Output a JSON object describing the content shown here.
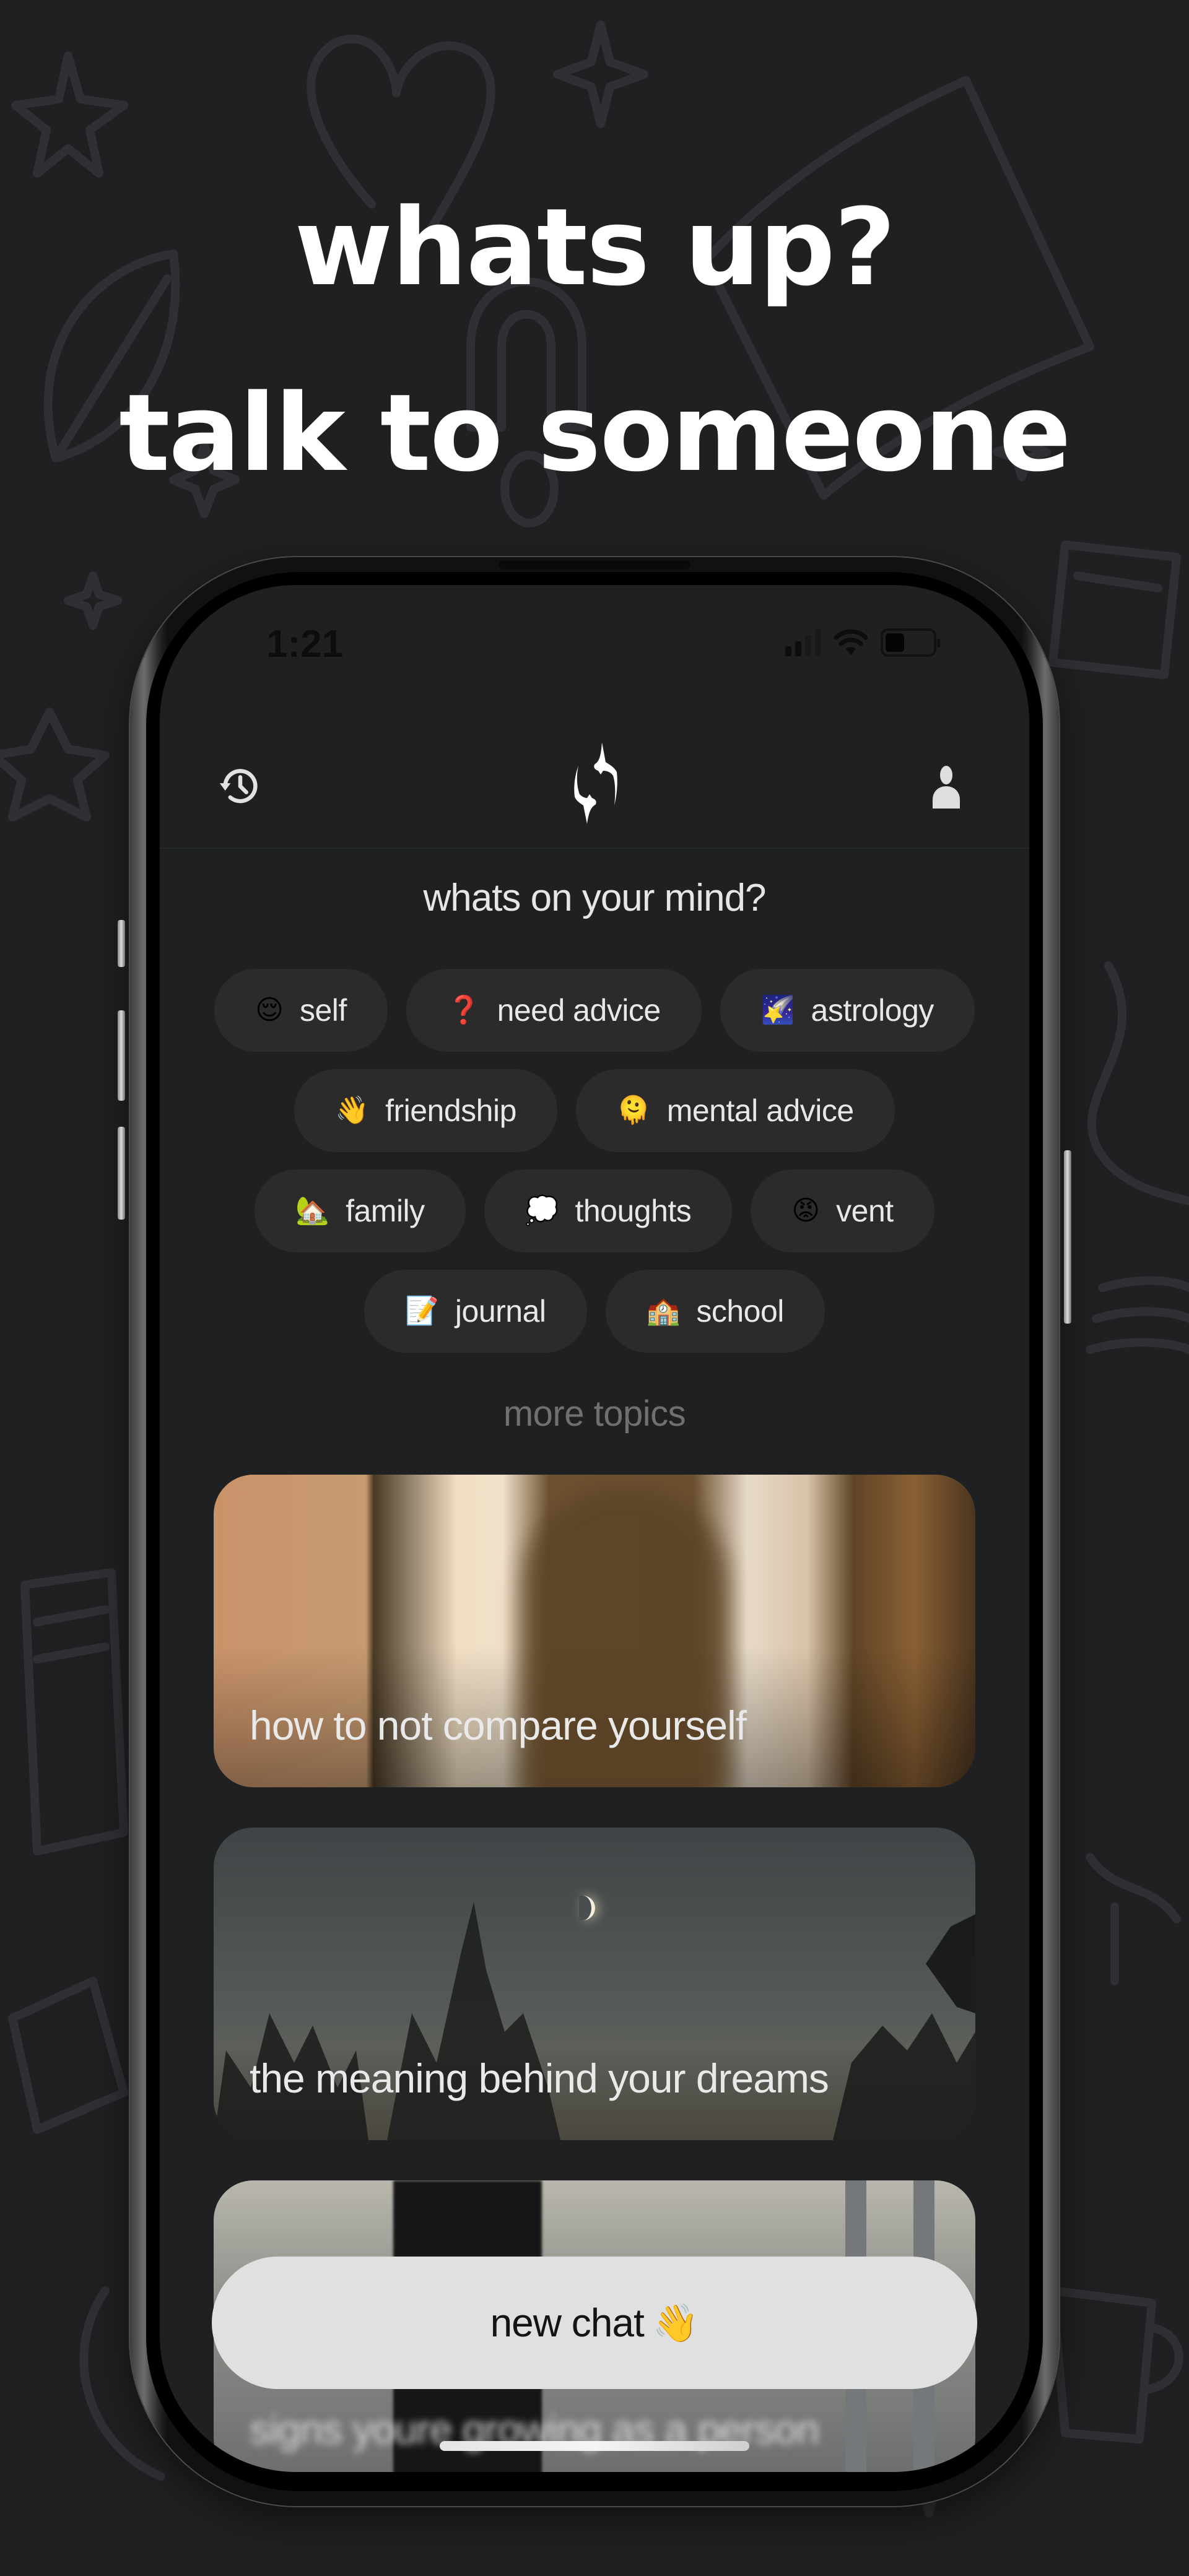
{
  "promo": {
    "headline_line1": "whats up?",
    "headline_line2": "talk to someone"
  },
  "status_bar": {
    "time": "1:21",
    "icons": [
      "cellular-signal-icon",
      "wifi-icon",
      "battery-icon"
    ],
    "battery_level_percent": 40
  },
  "header": {
    "left_icon": "history-icon",
    "logo_icon": "sparkles-icon",
    "right_icon": "profile-icon"
  },
  "main": {
    "title": "whats on your mind?",
    "topic_rows": [
      [
        {
          "emoji": "😌",
          "label": "self"
        },
        {
          "emoji": "❓",
          "label": "need advice"
        },
        {
          "emoji": "🌠",
          "label": "astrology"
        }
      ],
      [
        {
          "emoji": "👋",
          "label": "friendship"
        },
        {
          "emoji": "🫠",
          "label": "mental advice"
        }
      ],
      [
        {
          "emoji": "🏡",
          "label": "family"
        },
        {
          "emoji": "💭",
          "label": "thoughts"
        },
        {
          "emoji": "😡",
          "label": "vent"
        }
      ],
      [
        {
          "emoji": "📝",
          "label": "journal"
        },
        {
          "emoji": "🏫",
          "label": "school"
        }
      ]
    ],
    "more_topics_label": "more topics",
    "cards": [
      {
        "title": "how to not compare yourself"
      },
      {
        "title": "the meaning behind your dreams"
      },
      {
        "title": "signs youre growing as a person"
      }
    ],
    "new_chat_label": "new chat",
    "new_chat_emoji": "👋"
  },
  "colors": {
    "background": "#1f2022",
    "chip_background": "#2b2b2b",
    "chip_text": "#e8e8e8",
    "muted_text": "#707070",
    "button_background": "#e0e0e0",
    "button_text": "#141414"
  }
}
